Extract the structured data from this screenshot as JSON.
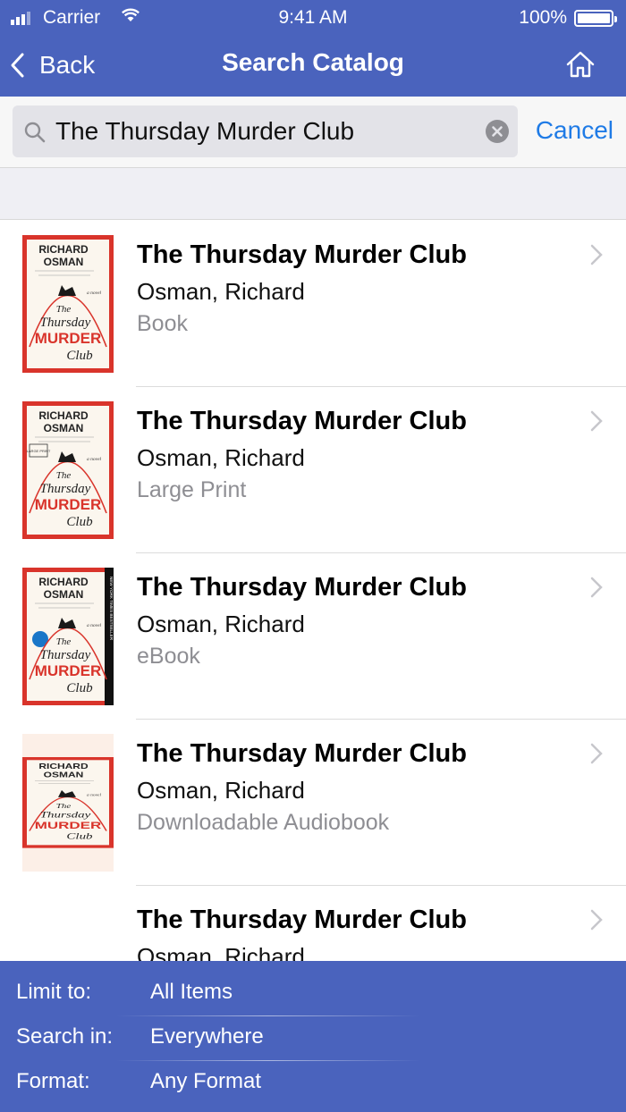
{
  "status_bar": {
    "carrier": "Carrier",
    "time": "9:41 AM",
    "battery_pct": "100%"
  },
  "nav": {
    "back_label": "Back",
    "title": "Search Catalog"
  },
  "search": {
    "query": "The Thursday Murder Club",
    "cancel_label": "Cancel"
  },
  "cover_text": {
    "author_line1": "RICHARD",
    "author_line2": "OSMAN",
    "title_line1": "The",
    "title_line2": "Thursday",
    "title_line3": "MURDER",
    "title_line4": "Club",
    "novel": "a novel",
    "large_print": "LARGE PRINT",
    "spine": "NEW YORK TIMES BESTSELLER"
  },
  "results": [
    {
      "title": "The Thursday Murder Club",
      "author": "Osman, Richard",
      "format": "Book",
      "cover_variant": "print"
    },
    {
      "title": "The Thursday Murder Club",
      "author": "Osman, Richard",
      "format": "Large Print",
      "cover_variant": "large-print"
    },
    {
      "title": "The Thursday Murder Club",
      "author": "Osman, Richard",
      "format": "eBook",
      "cover_variant": "ebook"
    },
    {
      "title": "The Thursday Murder Club",
      "author": "Osman, Richard",
      "format": "Downloadable Audiobook",
      "cover_variant": "audiobook"
    },
    {
      "title": "The Thursday Murder Club",
      "author": "Osman, Richard",
      "format": "",
      "cover_variant": "none"
    }
  ],
  "filters": [
    {
      "label": "Limit to:",
      "value": "All Items"
    },
    {
      "label": "Search in:",
      "value": "Everywhere"
    },
    {
      "label": "Format:",
      "value": "Any Format"
    }
  ],
  "colors": {
    "header_blue": "#4a63bd",
    "link_blue": "#1f7be6",
    "cover_red": "#d9342b",
    "secondary_text": "#8e8e93"
  },
  "icons": [
    "signal-icon",
    "wifi-icon",
    "battery-icon",
    "back-chevron-icon",
    "home-icon",
    "search-icon",
    "clear-icon",
    "chevron-right-icon",
    "book-cover-image"
  ]
}
